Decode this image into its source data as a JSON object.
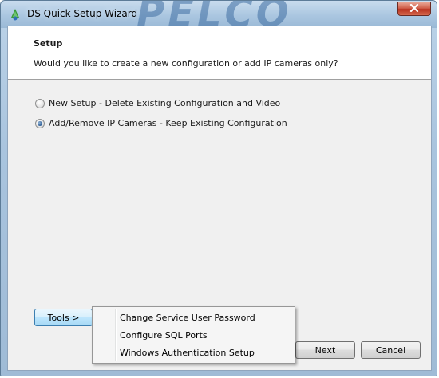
{
  "window": {
    "title": "DS Quick Setup Wizard",
    "watermark": "PELCO"
  },
  "header": {
    "title": "Setup",
    "subtitle": "Would you like to create a new configuration or add IP cameras only?"
  },
  "options": [
    {
      "label": "New Setup - Delete Existing Configuration and Video",
      "selected": false
    },
    {
      "label": "Add/Remove IP Cameras - Keep Existing Configuration",
      "selected": true
    }
  ],
  "buttons": {
    "tools": "Tools >",
    "next": "Next",
    "cancel": "Cancel"
  },
  "tools_menu": [
    "Change Service User Password",
    "Configure SQL Ports",
    "Windows Authentication Setup"
  ],
  "colors": {
    "accent": "#3c7fb1",
    "close": "#c7432e"
  }
}
